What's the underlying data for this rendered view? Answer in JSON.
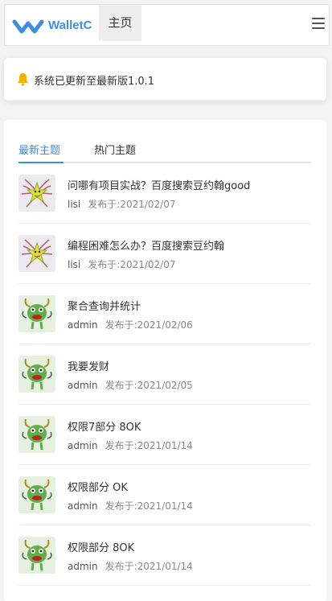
{
  "header": {
    "brand": "WalletC",
    "nav_home": "主页"
  },
  "notice": {
    "text": "系统已更新至最新版1.0.1"
  },
  "tabs": [
    {
      "label": "最新主题",
      "active": true
    },
    {
      "label": "热门主题",
      "active": false
    }
  ],
  "colors": {
    "accent": "#3a8ee6",
    "bell": "#f0b400"
  },
  "topics": [
    {
      "title": "问哪有项目实战？百度搜索豆约翰good",
      "author": "lisi",
      "date": "发布于:2021/02/07",
      "avatar": "yellow-bug-avatar"
    },
    {
      "title": "编程困难怎么办？百度搜索豆约翰",
      "author": "lisi",
      "date": "发布于:2021/02/07",
      "avatar": "yellow-bug-avatar"
    },
    {
      "title": "聚合查询并统计",
      "author": "admin",
      "date": "发布于:2021/02/06",
      "avatar": "green-monster-avatar"
    },
    {
      "title": "我要发财",
      "author": "admin",
      "date": "发布于:2021/02/05",
      "avatar": "green-monster-avatar"
    },
    {
      "title": "权限7部分 8OK",
      "author": "admin",
      "date": "发布于:2021/01/14",
      "avatar": "green-monster-avatar"
    },
    {
      "title": "权限部分 OK",
      "author": "admin",
      "date": "发布于:2021/01/14",
      "avatar": "green-monster-avatar"
    },
    {
      "title": "权限部分 8OK",
      "author": "admin",
      "date": "发布于:2021/01/14",
      "avatar": "green-monster-avatar"
    }
  ]
}
